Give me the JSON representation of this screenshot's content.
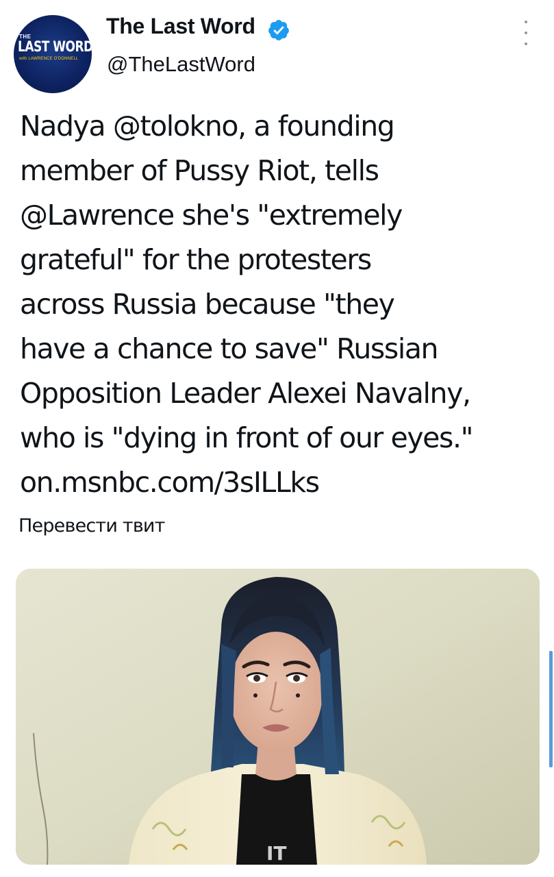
{
  "author": {
    "display_name": "The Last Word",
    "handle": "@TheLastWord",
    "verified": true,
    "avatar": {
      "logo_the": "THE",
      "logo_main": "LAST WORD",
      "logo_sub": "with LAWRENCE O'DONNELL"
    }
  },
  "tweet": {
    "lines": [
      "Nadya @tolokno, a founding",
      "member of Pussy Riot, tells",
      "@Lawrence she's \"extremely",
      "grateful\" for the protesters",
      "across Russia because \"they",
      "have a chance to save\" Russian",
      "Opposition Leader Alexei Navalny,",
      "who is \"dying in front of our eyes.\"",
      "on.msnbc.com/3sILLks"
    ]
  },
  "translate_label": "Перевести твит",
  "media": {
    "icon": "video-thumbnail",
    "shirt_text": "IT"
  },
  "colors": {
    "verified_badge": "#1d9bf0",
    "avatar_bg": "#0d2260",
    "text": "#0f1419",
    "more_icon": "#8b98a5",
    "scroll_indicator": "#5a9bd8"
  }
}
